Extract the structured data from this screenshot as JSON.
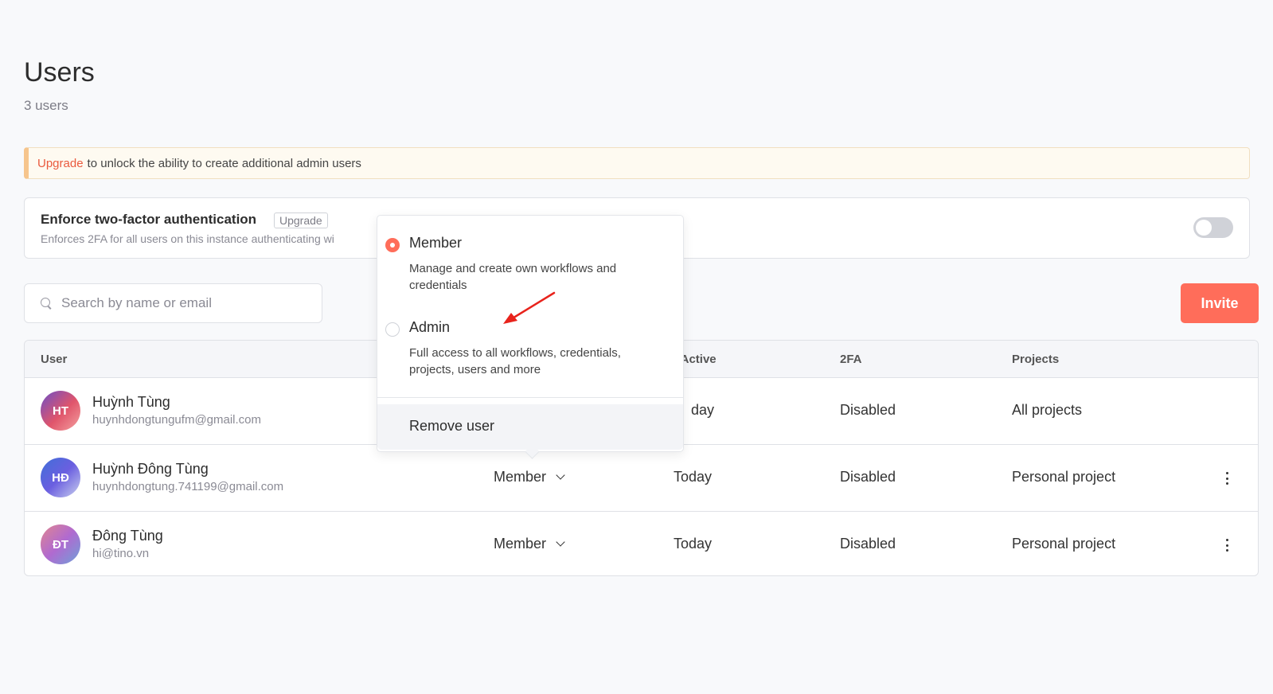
{
  "page": {
    "title": "Users",
    "subtitle": "3 users"
  },
  "banner": {
    "link": "Upgrade",
    "text": "to unlock the ability to create additional admin users"
  },
  "two_factor": {
    "title": "Enforce two-factor authentication",
    "badge": "Upgrade",
    "description": "Enforces 2FA for all users on this instance authenticating wi",
    "enabled": false
  },
  "search": {
    "placeholder": "Search by name or email",
    "value": ""
  },
  "invite_label": "Invite",
  "table": {
    "columns": {
      "user": "User",
      "last_active": "t Active",
      "twofa": "2FA",
      "projects": "Projects"
    },
    "rows": [
      {
        "initials": "HT",
        "name": "Huỳnh Tùng",
        "email": "huynhdongtungufm@gmail.com",
        "role": "",
        "last_active": "day",
        "twofa": "Disabled",
        "projects": "All projects"
      },
      {
        "initials": "HĐ",
        "name": "Huỳnh Đông Tùng",
        "email": "huynhdongtung.741199@gmail.com",
        "role": "Member",
        "last_active": "Today",
        "twofa": "Disabled",
        "projects": "Personal project"
      },
      {
        "initials": "ĐT",
        "name": "Đông Tùng",
        "email": "hi@tino.vn",
        "role": "Member",
        "last_active": "Today",
        "twofa": "Disabled",
        "projects": "Personal project"
      }
    ]
  },
  "role_dropdown": {
    "options": [
      {
        "label": "Member",
        "description": "Manage and create own workflows and credentials",
        "selected": true
      },
      {
        "label": "Admin",
        "description": "Full access to all workflows, credentials, projects, users and more",
        "selected": false
      }
    ],
    "remove_label": "Remove user"
  },
  "colors": {
    "accent": "#ff6d5a",
    "link": "#ea5a3e",
    "annotation_arrow": "#e8231c"
  },
  "icons": {
    "search": "search-icon",
    "chevron": "chevron-down-icon",
    "more": "kebab-menu-icon"
  }
}
